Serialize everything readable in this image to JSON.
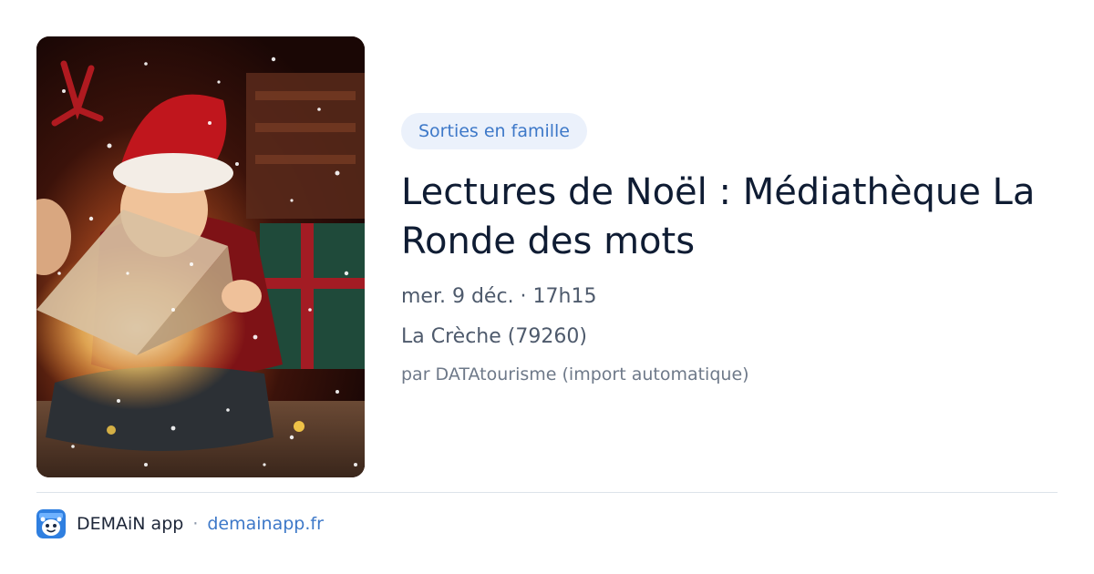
{
  "event": {
    "category": "Sorties en famille",
    "title": "Lectures de Noël : Médiathèque La Ronde des mots",
    "datetime": "mer. 9 déc. · 17h15",
    "location": "La Crèche (79260)",
    "source": "par DATAtourisme (import automatique)",
    "image_icon": "photo-child-reading-christmas-book"
  },
  "footer": {
    "app_name": "DEMAiN app",
    "separator": "·",
    "app_link": "demainapp.fr",
    "logo_icon": "demain-app-logo-icon"
  },
  "colors": {
    "accent": "#3d78c8",
    "chip_background": "#ebf1fb",
    "title": "#0f1c33",
    "text": "#4e5a6c",
    "muted": "#6e7989",
    "divider": "#dde3ea"
  }
}
